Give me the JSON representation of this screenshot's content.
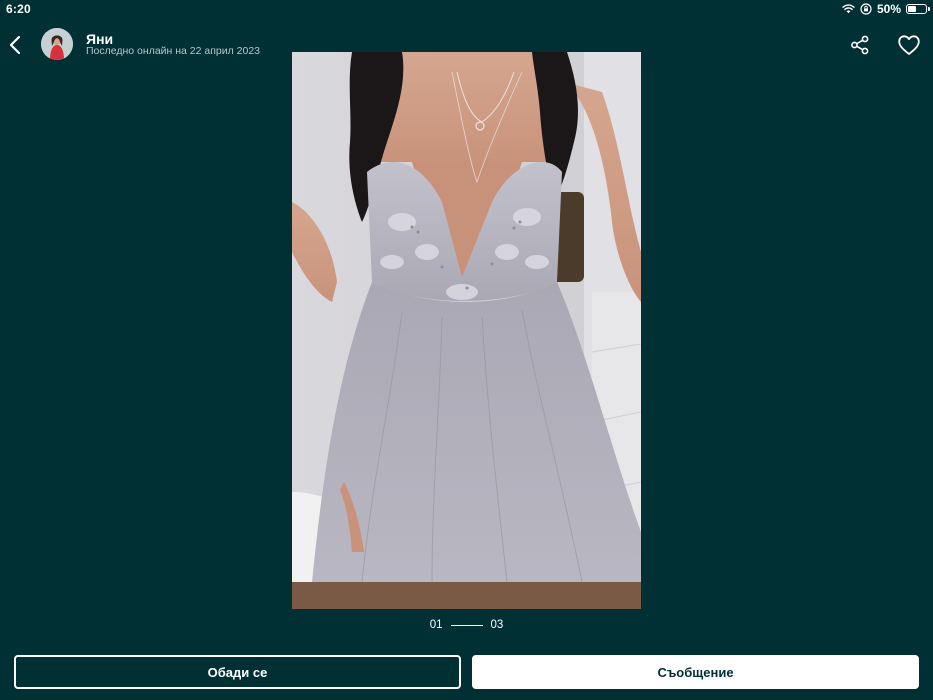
{
  "status_bar": {
    "time": "6:20",
    "battery_percent_label": "50%",
    "battery_level": 0.5,
    "icons": [
      "wifi-icon",
      "orientation-lock-icon",
      "battery-icon"
    ]
  },
  "header": {
    "back_icon": "chevron-left-icon",
    "user_name": "Яни",
    "last_online": "Последно онлайн на 22 април 2023",
    "share_icon": "share-icon",
    "favorite_icon": "heart-icon"
  },
  "gallery": {
    "current": "01",
    "total": "03"
  },
  "actions": {
    "call_label": "Обади се",
    "message_label": "Съобщение"
  },
  "colors": {
    "background": "#002f34",
    "text": "#ffffff",
    "muted_text": "#b8c7ca",
    "message_button_bg": "#ffffff"
  }
}
